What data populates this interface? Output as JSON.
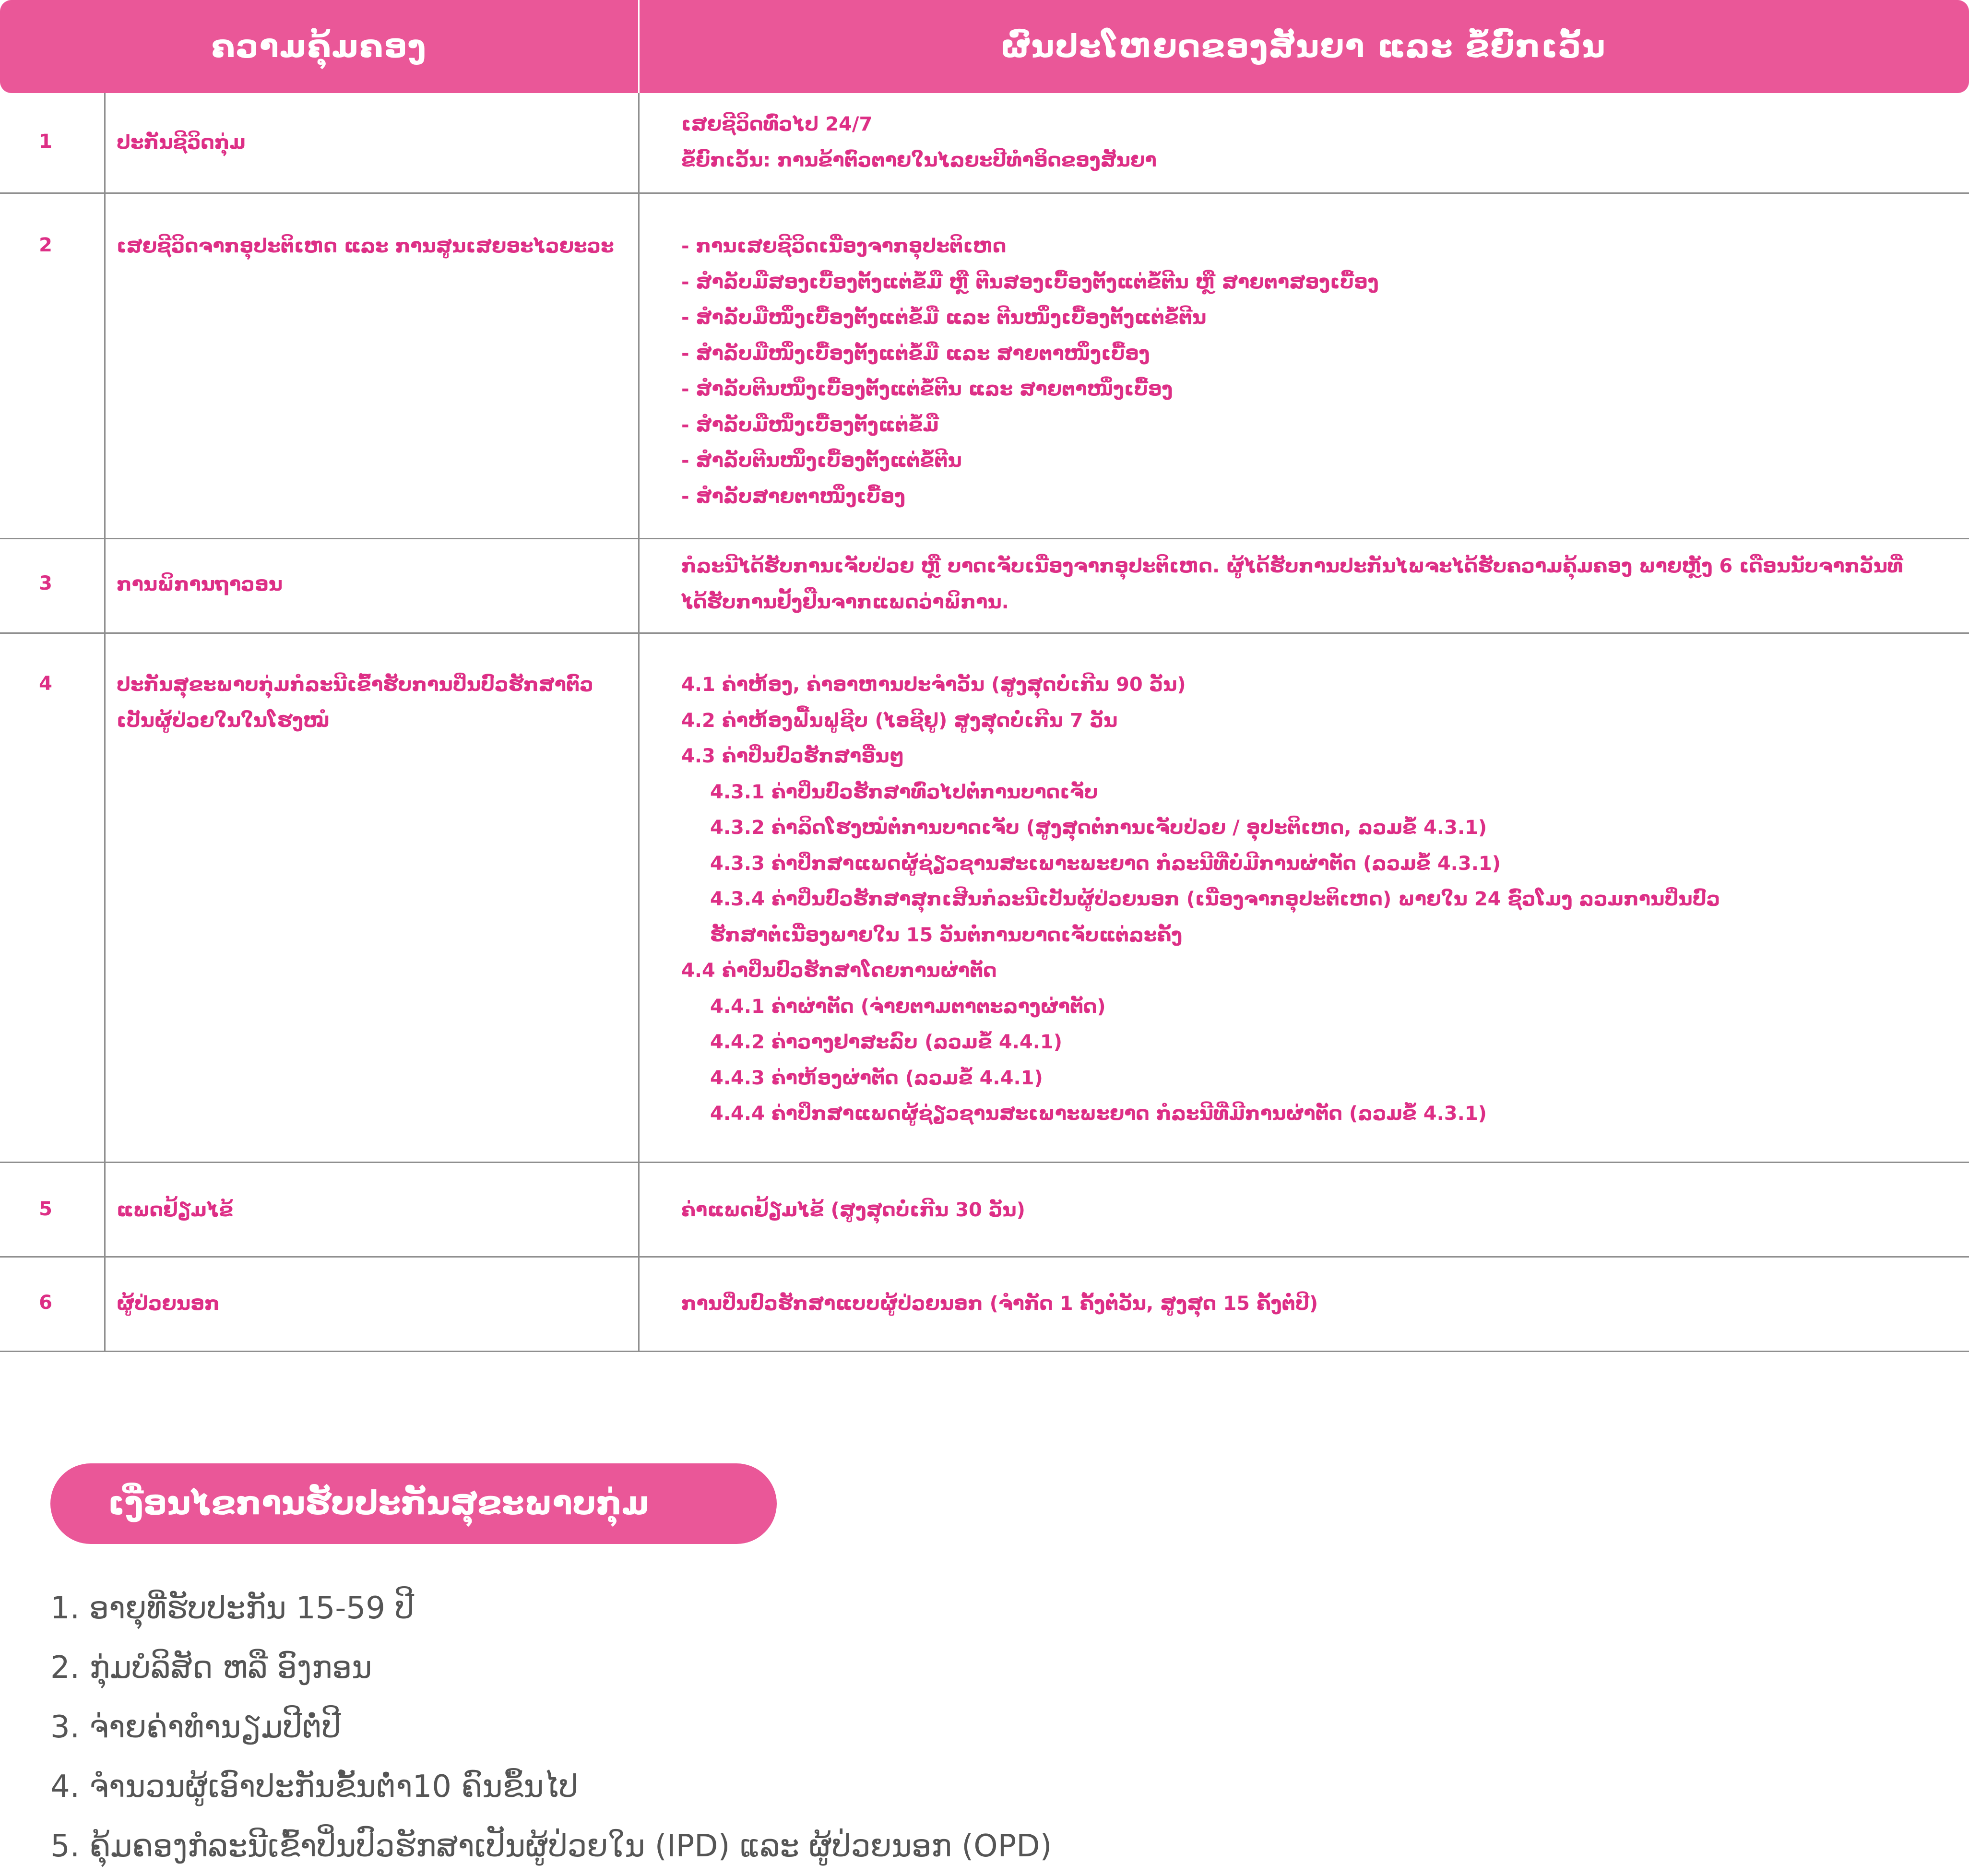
{
  "header": {
    "col1": "ຄວາມຄຸ້ມຄອງ",
    "col2": "ຜົນປະໂຫຍດຂອງສັນຍາ ແລະ ຂໍ້ຍົກເວັ້ນ"
  },
  "rows": [
    {
      "num": "1",
      "title": "ປະກັນຊີວິດກຸ່ມ",
      "lines": [
        "ເສຍຊີວິດທົ່ວໄປ 24/7",
        "ຂໍ້ຍົກເວັ້ນ: ການຂ້າຕົວຕາຍໃນໄລຍະປີທຳອິດຂອງສັນຍາ"
      ]
    },
    {
      "num": "2",
      "title": "ເສຍຊີວິດຈາກອຸປະຕິເຫດ  ແລະ ການສູນເສຍອະໄວຍະວະ",
      "lines": [
        "- ການເສຍຊີວິດເນື່ອງຈາກອຸປະຕິເຫດ",
        "- ສຳລັບມືສອງເບື້ອງຕັ້ງແຕ່ຂໍ້ມື ຫຼື ຕີນສອງເບື້ອງຕັ້ງແຕ່ຂໍ້ຕີນ ຫຼື ສາຍຕາສອງເບື້ອງ",
        "- ສຳລັບມືໜຶ່ງເບື້ອງຕັ້ງແຕ່ຂໍ້ມື ແລະ ຕີນໜຶ່ງເບື້ອງຕັ້ງແຕ່ຂໍ້ຕີນ",
        "- ສຳລັບມືໜຶ່ງເບື້ອງຕັ້ງແຕ່ຂໍ້ມື ແລະ ສາຍຕາໜຶ່ງເບື້ອງ",
        "- ສຳລັບຕີນໜຶ່ງເບື້ອງຕັ້ງແຕ່ຂໍ້ຕີນ ແລະ ສາຍຕາໜຶ່ງເບື້ອງ",
        "- ສຳລັບມືໜຶ່ງເບື້ອງຕັ້ງແຕ່ຂໍ້ມື",
        "- ສຳລັບຕີນໜຶ່ງເບື້ອງຕັ້ງແຕ່ຂໍ້ຕີນ",
        "- ສຳລັບສາຍຕາໜຶ່ງເບື້ອງ"
      ]
    },
    {
      "num": "3",
      "title": "ການພິການຖາວອນ",
      "lines": [
        "ກໍລະນີໄດ້ຮັບການເຈັບປ່ວຍ ຫຼື ບາດເຈັບເນື່ອງຈາກອຸປະຕິເຫດ. ຜູ້ໄດ້ຮັບການປະກັນໄພຈະໄດ້ຮັບຄວາມຄຸ້ມຄອງ ພາຍຫຼັງ 6 ເດືອນນັບຈາກວັນທີ່",
        "ໄດ້ຮັບການຢັ້ງຢືນຈາກແພດວ່າພິການ."
      ]
    },
    {
      "num": "4",
      "title_lines": [
        "ປະກັນສຸຂະພາບກຸ່ມກໍລະນີເຂົ້າຮັບການປິ່ນປົວຮັກສາຕົວ",
        "ເປັນຜູ້ປ່ວຍໃນໃນໂຮງໝໍ"
      ],
      "lines": [
        "4.1 ຄ່າຫ້ອງ, ຄ່າອາຫານປະຈຳວັນ (ສູງສຸດບໍ່ເກີນ 90 ວັນ)",
        "4.2 ຄ່າຫ້ອງຟື້ນຟູຊີບ (ໄອຊີຢູ) ສູງສຸດບໍ່ເກີນ 7 ວັນ",
        "4.3 ຄ່າປິ່ນປົວຮັກສາອື່ນໆ",
        "4.3.1 ຄ່າປິ່ນປົວຮັກສາທົ່ວໄປຕໍ່ການບາດເຈັບ",
        "4.3.2 ຄ່າລິດໂຮງໝໍຕໍ່ການບາດເຈັບ (ສູງສຸດຕໍ່ການເຈັບປ່ວຍ / ອຸປະຕິເຫດ, ລວມຂໍ້ 4.3.1)",
        "4.3.3 ຄ່າປຶກສາແພດຜູ້ຊ່ຽວຊານສະເພາະພະຍາດ ກໍລະນີທີ່ບໍ່ມີການຜ່າຕັດ (ລວມຂໍ້ 4.3.1)",
        "4.3.4 ຄ່າປິ່ນປົວຮັກສາສຸກເສີນກໍລະນີເປັນຜູ້ປ່ວຍນອກ (ເນື່ອງຈາກອຸປະຕິເຫດ) ພາຍໃນ 24 ຊົ່ວໂມງ ລວມການປິ່ນປົວ",
        "ຮັກສາຕໍ່ເນື່ອງພາຍໃນ 15 ວັນຕໍ່ການບາດເຈັບແຕ່ລະຄັ້ງ",
        "4.4 ຄ່າປິ່ນປົວຮັກສາໂດຍການຜ່າຕັດ",
        "4.4.1 ຄ່າຜ່າຕັດ (ຈ່າຍຕາມຕາຕະລາງຜ່າຕັດ)",
        "4.4.2 ຄ່າວາງຢາສະລົບ (ລວມຂໍ້ 4.4.1)",
        "4.4.3 ຄ່າຫ້ອງຜ່າຕັດ (ລວມຂໍ້ 4.4.1)",
        "4.4.4 ຄ່າປຶກສາແພດຜູ້ຊ່ຽວຊານສະເພາະພະຍາດ ກໍລະນີທີ່ມີການຜ່າຕັດ (ລວມຂໍ້ 4.3.1)"
      ]
    },
    {
      "num": "5",
      "title": "ແພດຢ້ຽມໄຂ້",
      "lines": [
        "ຄ່າແພດຢ້ຽມໄຂ້ (ສູງສຸດບໍ່ເກີນ 30 ວັນ)"
      ]
    },
    {
      "num": "6",
      "title": "ຜູ້ປ່ວຍນອກ",
      "lines": [
        "ການປິ່ນປົວຮັກສາແບບຜູ້ປ່ວຍນອກ (ຈຳກັດ 1 ຄັ້ງຕໍ່ວັນ, ສູງສຸດ 15 ຄັ້ງຕໍ່ປີ)"
      ]
    }
  ],
  "conditions": {
    "title": "ເງື່ອນໄຂການຮັບປະກັນສຸຂະພາບກຸ່ມ",
    "items": [
      "1. ອາຍຸທີ່ຮັບປະກັນ 15-59 ປີ",
      "2. ກຸ່ມບໍລິສັດ ຫລື ອົງກອນ",
      "3. ຈ່າຍຄ່າທຳນຽມປີຕໍ່ປີ",
      "4. ຈຳນວນຜູ້ເອົາປະກັນຂັ້ນຕ່ຳ10 ຄົນຂຶ້ນໄປ",
      "5. ຄຸ້ມຄອງກໍລະນີເຂົ້າປິ່ນປົວຮັກສາເປັນຜູ້ປ່ວຍໃນ (IPD) ແລະ ຜູ້ປ່ວຍນອກ (OPD)"
    ]
  }
}
